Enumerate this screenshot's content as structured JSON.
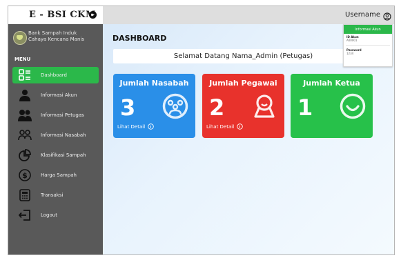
{
  "app": {
    "brand": "E - BSI CKM"
  },
  "sidebar": {
    "org_name_line1": "Bank Sampah Induk",
    "org_name_line2": "Cahaya Kencana Manis",
    "menu_title": "MENU",
    "items": [
      {
        "label": "Dashboard",
        "icon": "dashboard-icon",
        "active": true
      },
      {
        "label": "Informasi Akun",
        "icon": "user-icon",
        "active": false
      },
      {
        "label": "Informasi Petugas",
        "icon": "users-icon",
        "active": false
      },
      {
        "label": "Informasi Nasabah",
        "icon": "people-outline-icon",
        "active": false
      },
      {
        "label": "Klasifikasi Sampah",
        "icon": "pie-chart-icon",
        "active": false
      },
      {
        "label": "Harga Sampah",
        "icon": "dollar-icon",
        "active": false
      },
      {
        "label": "Transaksi",
        "icon": "calculator-icon",
        "active": false
      },
      {
        "label": "Logout",
        "icon": "logout-icon",
        "active": false
      }
    ]
  },
  "topbar": {
    "username": "Username"
  },
  "popup": {
    "title": "Informasi Akun",
    "id_label": "ID Akun",
    "id_value": "A00001",
    "password_label": "Password",
    "password_value": "1234"
  },
  "main": {
    "title": "DASHBOARD",
    "welcome": "Selamat Datang Nama_Admin (Petugas)",
    "cards": [
      {
        "title": "Jumlah Nasabah",
        "value": "3",
        "detail": "Lihat Detail",
        "color": "#2a8fe8",
        "icon": "group-icon"
      },
      {
        "title": "Jumlah Pegawai",
        "value": "2",
        "detail": "Lihat Detail",
        "color": "#e8322c",
        "icon": "worker-icon"
      },
      {
        "title": "Jumlah Ketua",
        "value": "1",
        "color": "#27c14a",
        "icon": "smile-icon"
      }
    ]
  },
  "colors": {
    "accent": "#2bb84a",
    "sidebar": "#595959"
  }
}
